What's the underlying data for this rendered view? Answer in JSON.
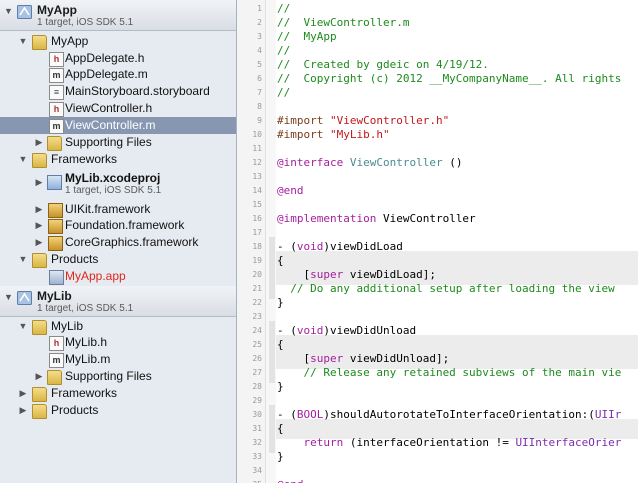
{
  "navigator": {
    "projects": [
      {
        "name": "MyApp",
        "subtitle": "1 target, iOS SDK 5.1",
        "items": [
          {
            "label": "MyApp",
            "icon": "folder-icon"
          },
          {
            "label": "AppDelegate.h",
            "icon": "header-file-icon"
          },
          {
            "label": "AppDelegate.m",
            "icon": "source-file-icon"
          },
          {
            "label": "MainStoryboard.storyboard",
            "icon": "storyboard-file-icon"
          },
          {
            "label": "ViewController.h",
            "icon": "header-file-icon"
          },
          {
            "label": "ViewController.m",
            "icon": "source-file-icon",
            "selected": true
          },
          {
            "label": "Supporting Files",
            "icon": "folder-icon"
          },
          {
            "label": "Frameworks",
            "icon": "folder-icon"
          },
          {
            "label": "MyLib.xcodeproj",
            "subtitle": "1 target, iOS SDK 5.1",
            "icon": "xcodeproj-icon"
          },
          {
            "label": "UIKit.framework",
            "icon": "framework-icon"
          },
          {
            "label": "Foundation.framework",
            "icon": "framework-icon"
          },
          {
            "label": "CoreGraphics.framework",
            "icon": "framework-icon"
          },
          {
            "label": "Products",
            "icon": "folder-icon"
          },
          {
            "label": "MyApp.app",
            "icon": "app-product-icon",
            "missing": true
          }
        ]
      },
      {
        "name": "MyLib",
        "subtitle": "1 target, iOS SDK 5.1",
        "items": [
          {
            "label": "MyLib",
            "icon": "folder-icon"
          },
          {
            "label": "MyLib.h",
            "icon": "header-file-icon"
          },
          {
            "label": "MyLib.m",
            "icon": "source-file-icon"
          },
          {
            "label": "Supporting Files",
            "icon": "folder-icon"
          },
          {
            "label": "Frameworks",
            "icon": "folder-icon"
          },
          {
            "label": "Products",
            "icon": "folder-icon"
          }
        ]
      }
    ],
    "colors": {
      "selection": "#8797b1",
      "missing_file": "#e0261a",
      "background": "#e6ebf1"
    }
  },
  "editor": {
    "file": "ViewController.m",
    "line_numbers": [
      "1",
      "2",
      "3",
      "4",
      "5",
      "6",
      "7",
      "8",
      "9",
      "10",
      "11",
      "12",
      "13",
      "14",
      "15",
      "16",
      "17",
      "18",
      "19",
      "20",
      "21",
      "22",
      "23",
      "24",
      "25",
      "26",
      "27",
      "28",
      "29",
      "30",
      "31",
      "32",
      "33",
      "34",
      "35"
    ],
    "lines": [
      "//",
      "//  ViewController.m",
      "//  MyApp",
      "//",
      "//  Created by gdeic on 4/19/12.",
      "//  Copyright (c) 2012 __MyCompanyName__. All rights",
      "//",
      "",
      "#import \"ViewController.h\"",
      "#import \"MyLib.h\"",
      "",
      "@interface ViewController ()",
      "",
      "@end",
      "",
      "@implementation ViewController",
      "",
      "- (void)viewDidLoad",
      "{",
      "    [super viewDidLoad];",
      "  // Do any additional setup after loading the view",
      "}",
      "",
      "- (void)viewDidUnload",
      "{",
      "    [super viewDidUnload];",
      "    // Release any retained subviews of the main vie",
      "}",
      "",
      "- (BOOL)shouldAutorotateToInterfaceOrientation:(UIIr",
      "{",
      "    return (interfaceOrientation != UIInterfaceOrier",
      "}",
      "",
      "@end"
    ],
    "colors": {
      "comment": "#1d8a1d",
      "preprocessor": "#7a3e1c",
      "string": "#c4161c",
      "keyword": "#a61e9e",
      "class": "#4b8b8f"
    }
  }
}
